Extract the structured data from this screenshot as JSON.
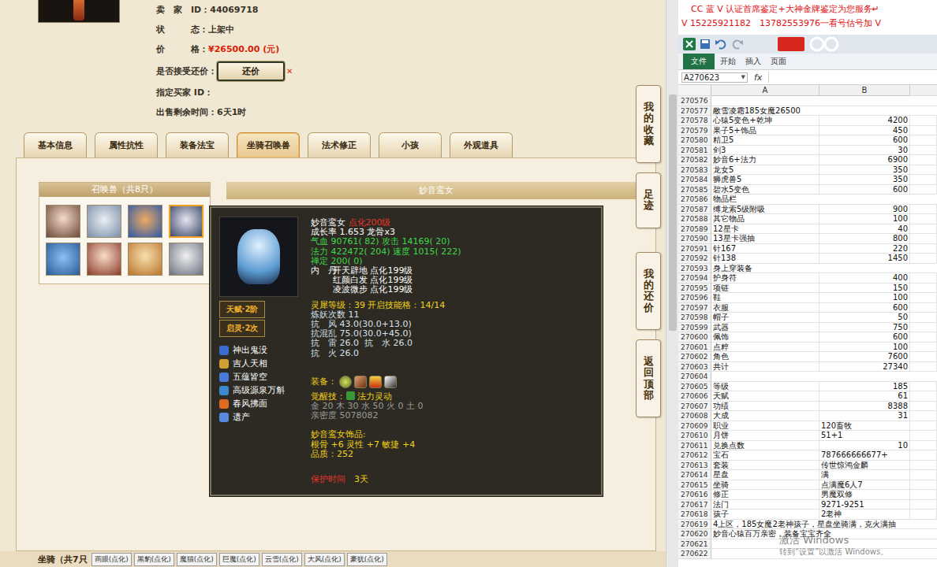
{
  "game": {
    "listing": [
      {
        "label": "卖　家　ID：",
        "value": "44069718",
        "kind": "text",
        "mark": ""
      },
      {
        "label": "状　　　态：",
        "value": "上架中",
        "kind": "text",
        "mark": ""
      },
      {
        "label": "价　　　格：",
        "value": "¥26500.00 (元)",
        "kind": "price",
        "mark": ""
      },
      {
        "label": "是否接受还价：",
        "value": "还价",
        "kind": "button",
        "mark": "✕"
      },
      {
        "label": "指定买家 ID：",
        "value": "",
        "kind": "text",
        "mark": ""
      },
      {
        "label": "出售剩余时间：",
        "value": "6天1时",
        "kind": "text",
        "mark": ""
      }
    ],
    "tabs": [
      {
        "label": "基本信息",
        "selected": false
      },
      {
        "label": "属性抗性",
        "selected": false
      },
      {
        "label": "装备法宝",
        "selected": false
      },
      {
        "label": "坐骑召唤兽",
        "selected": true
      },
      {
        "label": "法术修正",
        "selected": false
      },
      {
        "label": "小孩",
        "selected": false
      },
      {
        "label": "外观道具",
        "selected": false
      }
    ],
    "pets_title": "召唤兽（共8只）",
    "pets": [
      {
        "selected": false
      },
      {
        "selected": false
      },
      {
        "selected": false
      },
      {
        "selected": true
      },
      {
        "selected": false
      },
      {
        "selected": false
      },
      {
        "selected": false
      },
      {
        "selected": false
      }
    ],
    "detail_title": "妙音鸾女",
    "tooltip": {
      "name": "妙音鸾女",
      "level": "点化200级",
      "growth": "成长率 1.653 龙骨x3",
      "stats": [
        "气血 90761( 82) 攻击 14169( 20)",
        "法力 422472( 204) 速度 1015( 222)",
        "禅定 200( 0)"
      ],
      "neidan_label": "内　丹",
      "neidan": [
        "开天辟地 点化199级",
        "红颜白发 点化199级",
        "凌波微步 点化199级"
      ],
      "lingxi": "灵犀等级：39 开启技能格：14/14",
      "resists": [
        "炼妖次数 11",
        "抗　风 43.0(30.0+13.0)",
        "抗混乱 75.0(30.0+45.0)",
        "抗　雷 26.0  抗　水 26.0",
        "抗　火 26.0"
      ],
      "equip_label": "装备：",
      "equipment": [
        {
          "kind": "orb"
        },
        {
          "kind": "claw"
        },
        {
          "kind": "flame"
        },
        {
          "kind": "blade"
        }
      ],
      "awaken_label": "觉醒技：",
      "awaken": "法力灵动",
      "elements": "金 20 木 30 水 50 火 0 土 0",
      "intimacy": "亲密度 5078082",
      "ornament_title": "妙音鸾女饰品:",
      "ornament": "根骨 +6 灵性 +7 敏捷 +4",
      "quality": "品质：252",
      "protect_label": "保护时间",
      "protect": "3天",
      "badges": [
        "天赋·2阶",
        "启灵·2次"
      ],
      "skills": [
        {
          "name": "神出鬼没",
          "color": "#3a6cd0"
        },
        {
          "name": "吉人天相",
          "color": "#d0a030"
        },
        {
          "name": "五蕴皆空",
          "color": "#4a7ad8"
        },
        {
          "name": "高级源泉万斛",
          "color": "#3a8ad0"
        },
        {
          "name": "春风拂面",
          "color": "#e06a20"
        },
        {
          "name": "遗产",
          "color": "#5a8ae0"
        }
      ]
    },
    "side_tabs": [
      "我的收藏",
      "足迹",
      "我的还价",
      "返回顶部"
    ],
    "mounts": {
      "label": "坐骑（共7只",
      "items": [
        "画眼(点化)",
        "黑豹(点化)",
        "魔猫(点化)",
        "巨魔(点化)",
        "云雪(点化)",
        "大风(点化)",
        "豪犹(点化)"
      ]
    }
  },
  "cc_banner": [
    "CC 蓝 V 认证首席鉴定+大神金牌鉴定为您服务↵",
    "V 15225921182　13782553976一看号估号加 V"
  ],
  "excel": {
    "ribbon": [
      {
        "label": "文件",
        "selected": true
      },
      {
        "label": "开始",
        "selected": false
      },
      {
        "label": "插入",
        "selected": false
      },
      {
        "label": "页面",
        "selected": false
      }
    ],
    "name_box": "A270623",
    "name_arrow": "▼",
    "fx": "fx",
    "columns": [
      "A",
      "B"
    ],
    "rows": [
      {
        "n": "270576",
        "a": "",
        "b": "",
        "kind": "text"
      },
      {
        "n": "270577",
        "a": "敝雪凌霜185女魔26500",
        "b": "",
        "kind": "text"
      },
      {
        "n": "270578",
        "a": "心猿5变色+乾坤",
        "b": "4200",
        "kind": "num"
      },
      {
        "n": "270579",
        "a": "果子5+饰品",
        "b": "450",
        "kind": "num"
      },
      {
        "n": "270580",
        "a": "精卫5",
        "b": "600",
        "kind": "num"
      },
      {
        "n": "270581",
        "a": "剑3",
        "b": "30",
        "kind": "num"
      },
      {
        "n": "270582",
        "a": "妙音6+法力",
        "b": "6900",
        "kind": "num"
      },
      {
        "n": "270583",
        "a": "龙女5",
        "b": "350",
        "kind": "num"
      },
      {
        "n": "270584",
        "a": "狮虎兽5",
        "b": "350",
        "kind": "num"
      },
      {
        "n": "270585",
        "a": "碧水5变色",
        "b": "600",
        "kind": "num"
      },
      {
        "n": "270586",
        "a": "物品栏",
        "b": "",
        "kind": "text"
      },
      {
        "n": "270587",
        "a": "缚龙索5级附吸",
        "b": "900",
        "kind": "num"
      },
      {
        "n": "270588",
        "a": "其它物品",
        "b": "100",
        "kind": "num"
      },
      {
        "n": "270589",
        "a": "12星卡",
        "b": "40",
        "kind": "num"
      },
      {
        "n": "270590",
        "a": "13星卡强抽",
        "b": "800",
        "kind": "num"
      },
      {
        "n": "270591",
        "a": "针167",
        "b": "220",
        "kind": "num"
      },
      {
        "n": "270592",
        "a": "针138",
        "b": "1450",
        "kind": "num"
      },
      {
        "n": "270593",
        "a": "身上穿装备",
        "b": "",
        "kind": "text"
      },
      {
        "n": "270594",
        "a": "护身符",
        "b": "400",
        "kind": "num"
      },
      {
        "n": "270595",
        "a": "项链",
        "b": "150",
        "kind": "num"
      },
      {
        "n": "270596",
        "a": "鞋",
        "b": "100",
        "kind": "num"
      },
      {
        "n": "270597",
        "a": "衣服",
        "b": "600",
        "kind": "num"
      },
      {
        "n": "270598",
        "a": "帽子",
        "b": "50",
        "kind": "num"
      },
      {
        "n": "270599",
        "a": "武器",
        "b": "750",
        "kind": "num"
      },
      {
        "n": "270600",
        "a": "佩饰",
        "b": "600",
        "kind": "num"
      },
      {
        "n": "270601",
        "a": "点粹",
        "b": "100",
        "kind": "num"
      },
      {
        "n": "270602",
        "a": "角色",
        "b": "7600",
        "kind": "num"
      },
      {
        "n": "270603",
        "a": "共计",
        "b": "27340",
        "kind": "num"
      },
      {
        "n": "270604",
        "a": "",
        "b": "",
        "kind": "text"
      },
      {
        "n": "270605",
        "a": "等级",
        "b": "185",
        "kind": "num"
      },
      {
        "n": "270606",
        "a": "天赋",
        "b": "61",
        "kind": "num"
      },
      {
        "n": "270607",
        "a": "功绩",
        "b": "8388",
        "kind": "num"
      },
      {
        "n": "270608",
        "a": "大成",
        "b": "31",
        "kind": "num"
      },
      {
        "n": "270609",
        "a": "职业",
        "b": "120畜牧",
        "kind": "text"
      },
      {
        "n": "270610",
        "a": "月饼",
        "b": "51+1",
        "kind": "text"
      },
      {
        "n": "270611",
        "a": "兑换点数",
        "b": "10",
        "kind": "num"
      },
      {
        "n": "270612",
        "a": "宝石",
        "b": "787666666677+",
        "kind": "text"
      },
      {
        "n": "270613",
        "a": "套装",
        "b": "传世惊鸿金麟",
        "kind": "text"
      },
      {
        "n": "270614",
        "a": "星盘",
        "b": "满",
        "kind": "text"
      },
      {
        "n": "270615",
        "a": "坐骑",
        "b": "点满魔6人7",
        "kind": "text"
      },
      {
        "n": "270616",
        "a": "修正",
        "b": "男魔双修",
        "kind": "text"
      },
      {
        "n": "270617",
        "a": "法门",
        "b": "9271-9251",
        "kind": "text"
      },
      {
        "n": "270618",
        "a": "孩子",
        "b": "2老神",
        "kind": "text"
      },
      {
        "n": "270619",
        "a": "4上区，185女魔2老神孩子，星盘坐骑满，克火满抽",
        "b": "",
        "kind": "text"
      },
      {
        "n": "270620",
        "a": "妙音心猿百万亲密，装备宝宝齐全",
        "b": "",
        "kind": "text"
      },
      {
        "n": "270621",
        "a": "",
        "b": "",
        "kind": "text"
      },
      {
        "n": "270622",
        "a": "",
        "b": "",
        "kind": "text"
      }
    ]
  },
  "watermark": {
    "title": "激活 Windows",
    "hint": "转到“设置”以激活 Windows。"
  }
}
